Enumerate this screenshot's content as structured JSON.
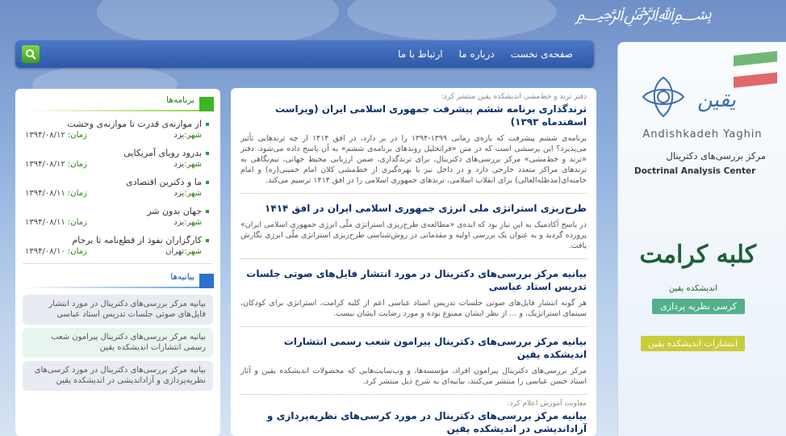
{
  "header": {
    "nav": [
      "صفحه‌ی نخست",
      "درباره ما",
      "ارتباط با ما"
    ],
    "search_icon": "search-icon"
  },
  "left": {
    "programs": {
      "title": "برنامه‌ها",
      "city_label": "شهر:",
      "time_label": "زمان:",
      "items": [
        {
          "title": "از موازنه‌ی قدرت تا موازنه‌ی وحشت",
          "city": "یزد",
          "date": "۱۳۹۴/۰۸/۱۲"
        },
        {
          "title": "بدرود رویای آمریکایی",
          "city": "یزد",
          "date": "۱۳۹۴/۰۸/۱۲"
        },
        {
          "title": "ما و دکترین اقتصادی",
          "city": "یزد",
          "date": "۱۳۹۴/۰۸/۱۱"
        },
        {
          "title": "جهان بدون شر",
          "city": "یزد",
          "date": "۱۳۹۴/۰۸/۱۱"
        },
        {
          "title": "کارگزاران نفوذ از قطع‌نامه تا برجام",
          "city": "تهران",
          "date": "۱۳۹۴/۰۸/۱۰"
        }
      ]
    },
    "statements": {
      "title": "بیانیه‌ها",
      "items": [
        "بیانیه مرکز بررسی‌های دکترینال در مورد انتشار فایل‌های صوتی جلسات تدریس استاد عباسی",
        "بیانیه مرکز بررسی‌های دکترینال پیرامون شعب رسمی انتشارات اندیشکده یقین",
        "بیانیه مرکز بررسی‌های دکترینال در مورد کرسی‌های نظریه‌پردازی و آزاداندیشی در اندیشکده یقین"
      ]
    }
  },
  "center": {
    "articles": [
      {
        "kicker": "دفتر ترند و خط‌مشی اندیشکده یقین منتشر کرد:",
        "title": "ترندگذاری برنامه ششم پیشرفت جمهوری اسلامی ایران (ویراست اسفندماه ۱۳۹۳)",
        "body": "برنامه‌ی ششم پیشرفت که بازه‌ی زمانی ۱۳۹۹-۱۳۹۴ را در بر دارد، در افق ۱۴۱۴ از چه ترندهایی تأثیر می‌پذیرد؟ این پرسشی است که در متن «فراتحلیل روندهای برنامه‌ی ششم» به آن پاسخ داده می‌شود. دفتر «ترند و خط‌مشی» مرکز بررسی‌های دکترینال، برای ترندگذاری، ضمن ارزیابی محیط جهانی، نیم‌نگاهی به ترندهای مراکز متعدد خارجی دارد و در داخل نیز با بهره‌گیری از خط‌مشی کلان امام خمینی(ره) و امام خامنه‌ای(مدظله‌العالی) برای انقلاب اسلامی، ترندهای جمهوری اسلامی را در افق ۱۴۱۴ ترسیم می‌کند."
      },
      {
        "kicker": "",
        "title": "طرح‌ریزی استراتژی ملی انرژی جمهوری اسلامی ایران در افق ۱۴۱۴",
        "body": "در پاسخ آکادمیک به این نیاز بود که ایده‌ی «مطالعه‌ی طرح‌ریزی استراتژی ملّی انرژی جمهوری اسلامی ایران» پرورده گردید و به عنوان یک بررسی اولیه و مقدماتی در روش‌شناسی طرح‌ریزی استراتژی ملّی انرژی نگارش یافت."
      },
      {
        "kicker": "",
        "title": "بیانیه مرکز بررسی‌های دکترینال در مورد انتشار فایل‌های صوتی جلسات تدریس استاد عباسی",
        "body": "هر گونه انتشار فایل‌های صوتی جلسات تدریس استاد عباسی اعم از کلبه کرامت، استراتژی برای کودکان، سینمای استراتژیک، و ... از نظر ایشان ممنوع بوده و مورد رضایت ایشان نیست."
      },
      {
        "kicker": "",
        "title": "بیانیه مرکز بررسی‌های دکترینال پیرامون شعب رسمی انتشارات اندیشکده یقین",
        "body": "مرکز بررسی‌های دکترینال پیرامون افراد، مؤسسه‌ها، و وب‌سایت‌هایی که محصولات اندیشکده یقین و آثار استاد حسن عباسی را منتشر می‌کنند، بیانیه‌ای به شرح ذیل منتشر کرد."
      },
      {
        "kicker": "معاونت آموزش اعلام کرد:",
        "title": "بیانیه مرکز بررسی‌های دکترینال در مورد کرسی‌های نظریه‌پردازی و آزاداندیشی در اندیشکده یقین",
        "body": ""
      }
    ]
  },
  "right": {
    "brand_latin": "Andishkadeh Yaghin",
    "center_fa": "مرکز بررسی‌های دکترینال",
    "center_en": "Doctrinal Analysis Center",
    "karamat_title": "کلبه کرامت",
    "karamat_sub": "اندیشکده یقین",
    "course_pill": "کرسی نظریه پردازی",
    "publish_pill": "انتشارات اندیشکده یقین"
  },
  "colors": {
    "accent_green": "#3db624",
    "accent_blue": "#2e6fd0",
    "title_blue": "#0b2f6a"
  }
}
